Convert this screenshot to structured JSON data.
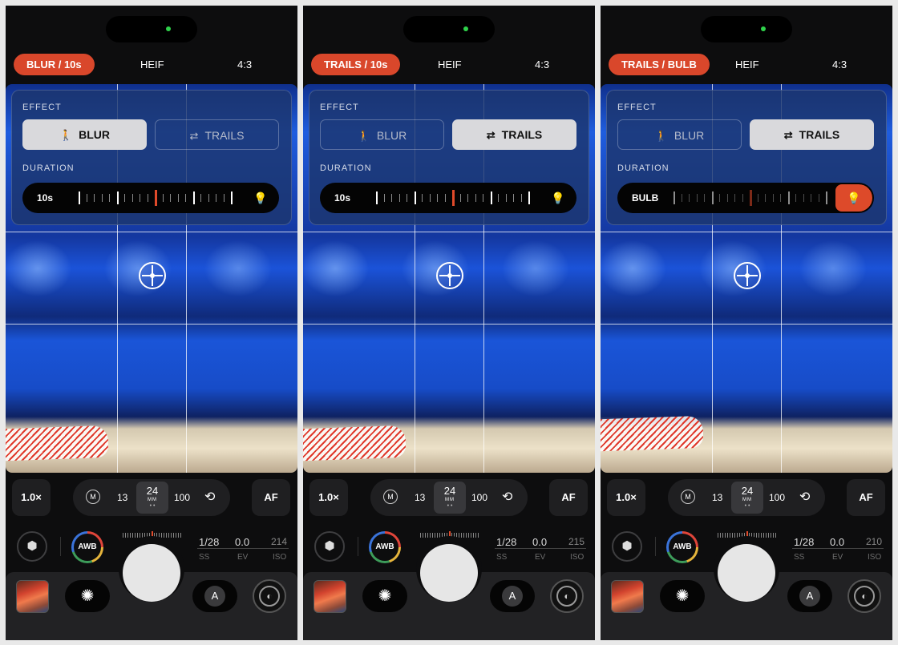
{
  "screens": [
    {
      "mode_pill": "BLUR / 10s",
      "format": "HEIF",
      "aspect_ratio": "4:3",
      "effect_label": "EFFECT",
      "effect_options": [
        "BLUR",
        "TRAILS"
      ],
      "selected_effect": "BLUR",
      "duration_label": "DURATION",
      "duration_value": "10s",
      "bulb_active": false,
      "zoom": "1.0×",
      "lens_mode": "M",
      "lenses": [
        "13",
        "24",
        "100"
      ],
      "lens_selected_unit": "MM",
      "af": "AF",
      "awb": "AWB",
      "shutter_speed": "1/28",
      "ev": "0.0",
      "iso": "214",
      "ss_label": "SS",
      "ev_label": "EV",
      "iso_label": "ISO",
      "auto_label": "A"
    },
    {
      "mode_pill": "TRAILS / 10s",
      "format": "HEIF",
      "aspect_ratio": "4:3",
      "effect_label": "EFFECT",
      "effect_options": [
        "BLUR",
        "TRAILS"
      ],
      "selected_effect": "TRAILS",
      "duration_label": "DURATION",
      "duration_value": "10s",
      "bulb_active": false,
      "zoom": "1.0×",
      "lens_mode": "M",
      "lenses": [
        "13",
        "24",
        "100"
      ],
      "lens_selected_unit": "MM",
      "af": "AF",
      "awb": "AWB",
      "shutter_speed": "1/28",
      "ev": "0.0",
      "iso": "215",
      "ss_label": "SS",
      "ev_label": "EV",
      "iso_label": "ISO",
      "auto_label": "A"
    },
    {
      "mode_pill": "TRAILS / BULB",
      "format": "HEIF",
      "aspect_ratio": "4:3",
      "effect_label": "EFFECT",
      "effect_options": [
        "BLUR",
        "TRAILS"
      ],
      "selected_effect": "TRAILS",
      "duration_label": "DURATION",
      "duration_value": "BULB",
      "bulb_active": true,
      "zoom": "1.0×",
      "lens_mode": "M",
      "lenses": [
        "13",
        "24",
        "100"
      ],
      "lens_selected_unit": "MM",
      "af": "AF",
      "awb": "AWB",
      "shutter_speed": "1/28",
      "ev": "0.0",
      "iso": "210",
      "ss_label": "SS",
      "ev_label": "EV",
      "iso_label": "ISO",
      "auto_label": "A"
    }
  ],
  "icons": {
    "blur_effect": "walking-person-icon",
    "trails_effect": "trails-icon",
    "bulb": "lightbulb-icon",
    "flip": "flip-camera-icon",
    "cube": "cube-icon",
    "aperture": "aperture-icon",
    "blur_mode": "blur-mode-icon"
  },
  "colors": {
    "accent": "#d9472b",
    "selected_button": "#d9d9dc",
    "panel": "#1c366e"
  }
}
